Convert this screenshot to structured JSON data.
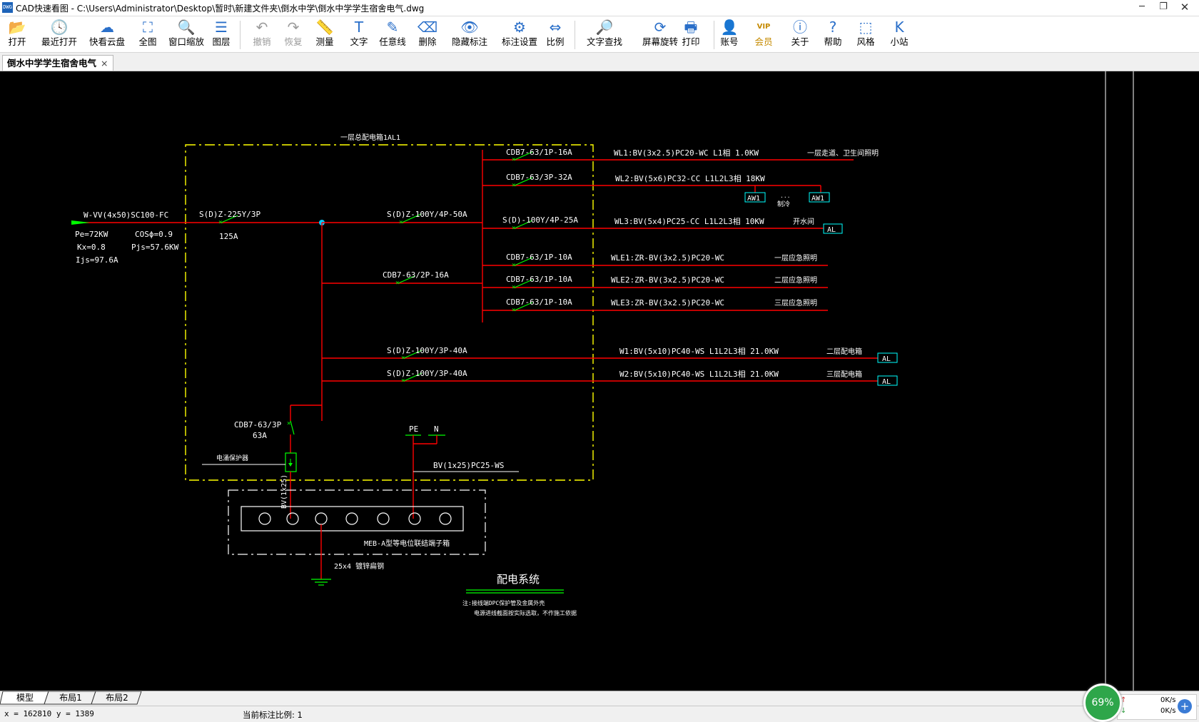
{
  "window": {
    "icon": "DWG",
    "title": "CAD快速看图 - C:\\Users\\Administrator\\Desktop\\暂时\\新建文件夹\\倒水中学\\倒水中学学生宿舍电气.dwg",
    "min_icon": "minimize-icon",
    "restore_icon": "restore-icon",
    "close_icon": "close-icon"
  },
  "toolbar": [
    {
      "label": "打开",
      "icon": "folder-open-icon",
      "glyph": "📂",
      "enabled": true
    },
    {
      "label": "最近打开",
      "icon": "clock-icon",
      "glyph": "🕓",
      "enabled": true
    },
    {
      "label": "快看云盘",
      "icon": "cloud-icon",
      "glyph": "☁",
      "enabled": true
    },
    {
      "label": "全图",
      "icon": "fit-view-icon",
      "glyph": "⛶",
      "enabled": true
    },
    {
      "label": "窗口缩放",
      "icon": "zoom-window-icon",
      "glyph": "🔍",
      "enabled": true
    },
    {
      "label": "图层",
      "icon": "layers-icon",
      "glyph": "☰",
      "enabled": true
    },
    {
      "label": "撤销",
      "icon": "undo-icon",
      "glyph": "↶",
      "enabled": false
    },
    {
      "label": "恢复",
      "icon": "redo-icon",
      "glyph": "↷",
      "enabled": false
    },
    {
      "label": "测量",
      "icon": "measure-icon",
      "glyph": "📏",
      "enabled": true
    },
    {
      "label": "文字",
      "icon": "text-icon",
      "glyph": "T",
      "enabled": true
    },
    {
      "label": "任意线",
      "icon": "pen-icon",
      "glyph": "✎",
      "enabled": true
    },
    {
      "label": "删除",
      "icon": "eraser-icon",
      "glyph": "⌫",
      "enabled": true
    },
    {
      "label": "隐藏标注",
      "icon": "eye-hide-icon",
      "glyph": "👁",
      "enabled": true
    },
    {
      "label": "标注设置",
      "icon": "annotation-settings-icon",
      "glyph": "⚙",
      "enabled": true
    },
    {
      "label": "比例",
      "icon": "scale-icon",
      "glyph": "⇔",
      "enabled": true
    },
    {
      "label": "文字查找",
      "icon": "text-search-icon",
      "glyph": "🔎",
      "enabled": true
    },
    {
      "label": "屏幕旋转",
      "icon": "rotate-screen-icon",
      "glyph": "⟳",
      "enabled": true
    },
    {
      "label": "打印",
      "icon": "printer-icon",
      "glyph": "🖶",
      "enabled": true
    },
    {
      "label": "账号",
      "icon": "user-icon",
      "glyph": "👤",
      "enabled": true
    },
    {
      "label": "会员",
      "icon": "vip-icon",
      "glyph": "VIP",
      "enabled": true
    },
    {
      "label": "关于",
      "icon": "info-icon",
      "glyph": "ⓘ",
      "enabled": true
    },
    {
      "label": "帮助",
      "icon": "help-icon",
      "glyph": "?",
      "enabled": true
    },
    {
      "label": "风格",
      "icon": "style-icon",
      "glyph": "⬚",
      "enabled": true
    },
    {
      "label": "小站",
      "icon": "site-icon",
      "glyph": "K",
      "enabled": true
    }
  ],
  "document_tab": {
    "label": "倒水中学学生宿舍电气",
    "close": "×"
  },
  "drawing": {
    "box_title": "一层总配电箱1AL1",
    "incoming_cable": "W-VV(4x50)SC100-FC",
    "pe": "Pe=72KW",
    "cos": "COSϕ=0.9",
    "kx": "Kx=0.8",
    "pjs": "Pjs=57.6KW",
    "ijs": "Ijs=97.6A",
    "main_breaker": "S(D)Z-225Y/3P",
    "main_breaker_rating": "125A",
    "br_50a": "S(D)Z-100Y/4P-50A",
    "br_16a_2p": "CDB7-63/2P-16A",
    "br_40a_1": "S(D)Z-100Y/3P-40A",
    "br_40a_2": "S(D)Z-100Y/3P-40A",
    "spd_breaker": "CDB7-63/3P",
    "spd_breaker_rating": "63A",
    "spd_label": "电涌保护器",
    "pe_label": "PE",
    "n_label": "N",
    "pe_cable": "BV(1x25)PC25-WS",
    "ground_cable": "BV(1x25)",
    "terminal_box": "MEB-A型等电位联结端子箱",
    "earth_conductor": "25x4 镀锌扁钢",
    "circuits": [
      {
        "breaker": "CDB7-63/1P-16A",
        "cable": "WL1:BV(3x2.5)PC20-WC   L1相 1.0KW",
        "load": "一层走道、卫生间照明"
      },
      {
        "breaker": "CDB7-63/3P-32A",
        "cable": "WL2:BV(5x6)PC32-CC   L1L2L3相 18KW",
        "load": ""
      },
      {
        "breaker": "S(D)-100Y/4P-25A",
        "cable": "WL3:BV(5x4)PC25-CC   L1L2L3相 10KW",
        "load": "开水间"
      },
      {
        "breaker": "CDB7-63/1P-10A",
        "cable": "WLE1:ZR-BV(3x2.5)PC20-WC",
        "load": "一层应急照明"
      },
      {
        "breaker": "CDB7-63/1P-10A",
        "cable": "WLE2:ZR-BV(3x2.5)PC20-WC",
        "load": "二层应急照明"
      },
      {
        "breaker": "CDB7-63/1P-10A",
        "cable": "WLE3:ZR-BV(3x2.5)PC20-WC",
        "load": "三层应急照明"
      },
      {
        "breaker": "S(D)Z-100Y/3P-40A",
        "cable": "W1:BV(5x10)PC40-WS   L1L2L3相 21.0KW",
        "load": "二层配电箱"
      },
      {
        "breaker": "S(D)Z-100Y/3P-40A",
        "cable": "W2:BV(5x10)PC40-WS   L1L2L3相 21.0KW",
        "load": "三层配电箱"
      }
    ],
    "aw1_left": "AW1",
    "aw1_right": "AW1",
    "aw_note_dots": "...",
    "aw_note": "制冷",
    "al_wl3": "AL",
    "al_w1": "AL",
    "al_w2": "AL",
    "system_title": "配电系统",
    "note_line1": "注:接线端DPC保护管及金属外壳",
    "note_line2": "电源进线截面按实际选取，不作施工依据"
  },
  "layout_tabs": [
    "模型",
    "布局1",
    "布局2"
  ],
  "status": {
    "coords": "x = 162810  y = 1389",
    "scale": "当前标注比例: 1"
  },
  "perf": {
    "value": "69%",
    "up": "0K/s",
    "down": "0K/s",
    "up_arrow": "↑",
    "down_arrow": "↓",
    "plus": "+"
  },
  "colors": {
    "canvas": "#000000",
    "wire": "#ff0000",
    "box_border": "#ffff00",
    "text": "#ffffff",
    "tag_border": "#00ffff",
    "breaker": "#00ff00"
  }
}
